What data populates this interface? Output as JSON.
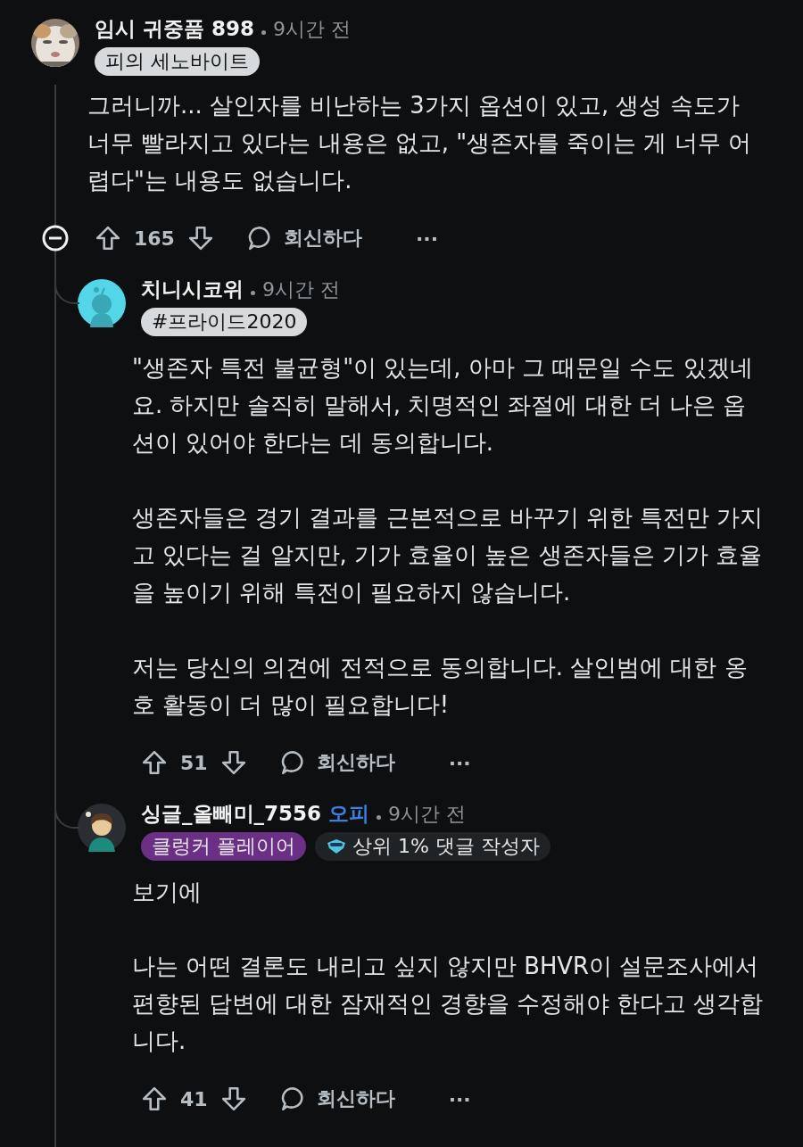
{
  "comments": [
    {
      "author": "임시 귀중품 898",
      "time": "9시간 전",
      "flairs": [
        {
          "kind": "text",
          "label": "피의 세노바이트",
          "color": "#d7dadc"
        }
      ],
      "paragraphs": [
        "그러니까... 살인자를 비난하는 3가지 옵션이 있고, 생성 속도가 너무 빨라지고 있다는 내용은 없고, \"생존자를 죽이는 게 너무 어렵다\"는 내용도 없습니다."
      ],
      "score": "165",
      "reply": "회신하다",
      "more": "···",
      "collapsible": true
    },
    {
      "author": "치니시코위",
      "time": "9시간 전",
      "flairs": [
        {
          "kind": "text",
          "label": "#프라이드2020",
          "color": "#d7dadc"
        }
      ],
      "paragraphs": [
        "\"생존자 특전 불균형\"이 있는데, 아마 그 때문일 수도 있겠네요. 하지만 솔직히 말해서, 치명적인 좌절에 대한 더 나은 옵션이 있어야 한다는 데 동의합니다.",
        "생존자들은 경기 결과를 근본적으로 바꾸기 위한 특전만 가지고 있다는 걸 알지만, 기가 효율이 높은 생존자들은 기가 효율을 높이기 위해 특전이 필요하지 않습니다.",
        "저는 당신의 의견에 전적으로 동의합니다. 살인범에 대한 옹호 활동이 더 많이 필요합니다!"
      ],
      "score": "51",
      "reply": "회신하다",
      "more": "···",
      "collapsible": false
    },
    {
      "author": "싱글_올빼미_7556",
      "op_label": "오피",
      "time": "9시간 전",
      "flairs": [
        {
          "kind": "text",
          "label": "클렁커 플레이어",
          "color": "#6b2f86"
        },
        {
          "kind": "achievement",
          "label": "상위 1% 댓글 작성자",
          "color": "#1f2326"
        }
      ],
      "paragraphs": [
        "보기에",
        "나는 어떤 결론도 내리고 싶지 않지만 BHVR이 설문조사에서 편향된 답변에 대한 잠재적인 경향을 수정해야 한다고 생각합니다."
      ],
      "score": "41",
      "reply": "회신하다",
      "more": "···",
      "collapsible": false
    }
  ]
}
